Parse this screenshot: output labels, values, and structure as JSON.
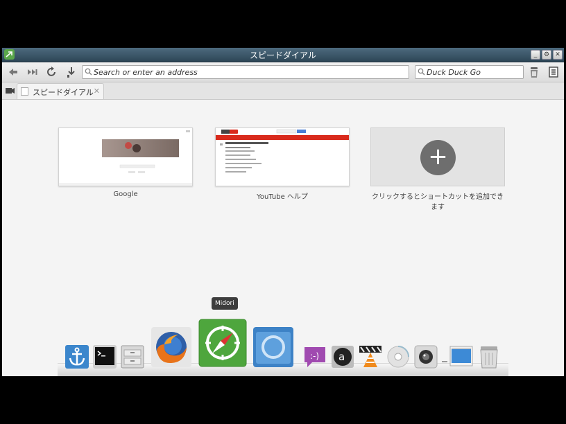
{
  "window": {
    "title": "スピードダイアル"
  },
  "toolbar": {
    "back_icon": "back-icon",
    "forward_icon": "fast-forward-icon",
    "reload_icon": "reload-icon",
    "bookmark_icon": "download-arrow-icon",
    "address_placeholder": "Search or enter an address",
    "search_placeholder": "Duck Duck Go",
    "tools_icon": "trash-icon",
    "menu_icon": "menu-icon"
  },
  "tabs": [
    {
      "label": "スピードダイアル",
      "close": "✕"
    }
  ],
  "speed_dial": {
    "tiles": [
      {
        "label": "Google"
      },
      {
        "label": "YouTube ヘルプ"
      },
      {
        "label": "クリックするとショートカットを追加できます",
        "plus": "+"
      }
    ]
  },
  "dock": {
    "tooltip": "Midori",
    "items": [
      {
        "name": "anchor-icon"
      },
      {
        "name": "terminal-icon"
      },
      {
        "name": "file-cabinet-icon"
      },
      {
        "name": "firefox-icon"
      },
      {
        "name": "midori-icon"
      },
      {
        "name": "chromium-icon"
      },
      {
        "name": "chat-bubble-icon"
      },
      {
        "name": "amazon-icon"
      },
      {
        "name": "vlc-icon"
      },
      {
        "name": "disc-icon"
      },
      {
        "name": "webcam-icon"
      },
      {
        "name": "desktop-window-icon"
      },
      {
        "name": "trash-icon"
      }
    ]
  },
  "colors": {
    "titlebar": "#3b5566",
    "midori_green": "#4ea63d",
    "youtube_red": "#d92a1c"
  }
}
